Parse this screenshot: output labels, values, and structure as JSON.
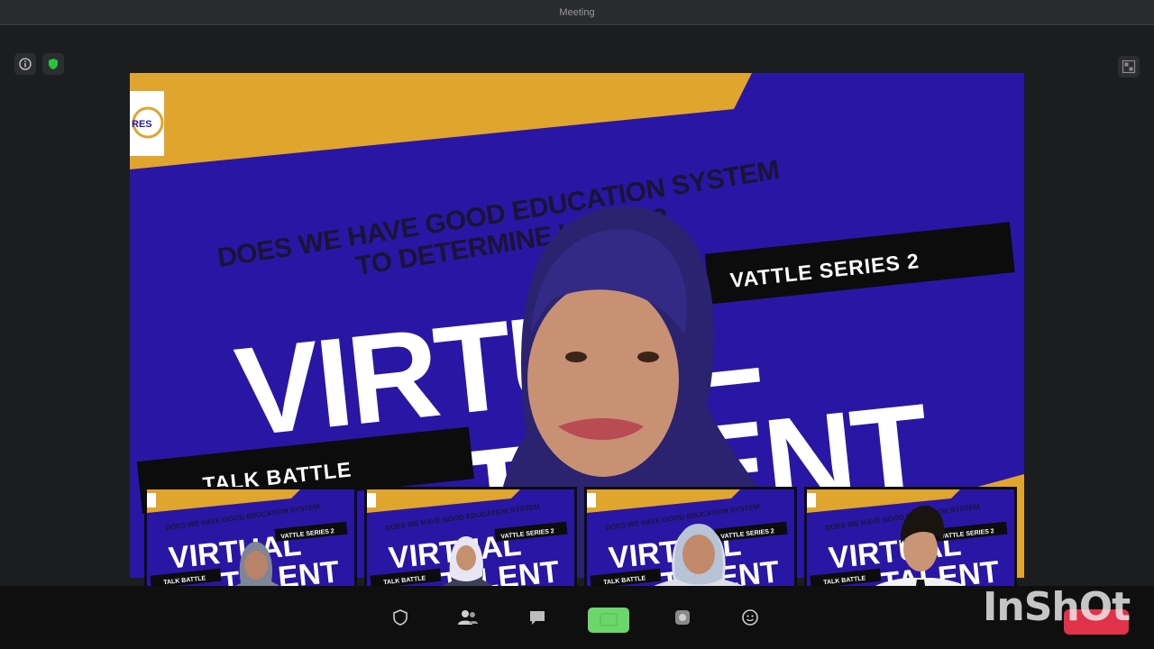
{
  "window": {
    "title": "Meeting"
  },
  "slide": {
    "logo_text": "RES",
    "question_line1": "DOES WE HAVE GOOD EDUCATION SYSTEM",
    "question_line2": "TO DETERMINE KSAOS?",
    "word1": "VIRTUAL",
    "word2": "TALENT",
    "series": "VATTLE SERIES 2",
    "talk": "TALK BATTLE"
  },
  "colors": {
    "slide_blue": "#2a16a4",
    "slide_gold": "#e0a52c",
    "share_green": "#6bd66a",
    "end_red": "#e0334a"
  },
  "toolbar": {
    "icons": [
      "security-icon",
      "participants-icon",
      "chat-icon",
      "share-screen-icon",
      "record-icon",
      "reactions-icon"
    ]
  },
  "watermark": "InShOt"
}
